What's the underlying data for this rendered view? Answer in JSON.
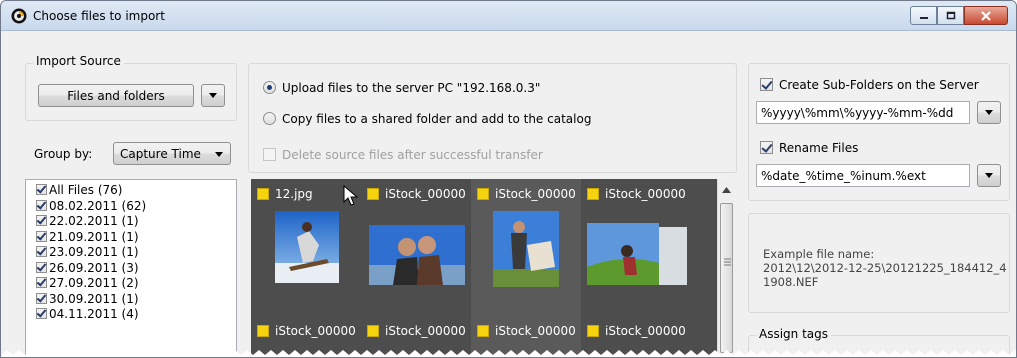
{
  "window": {
    "title": "Choose files to import",
    "controls": [
      "minimize-icon",
      "maximize-icon",
      "close-icon"
    ]
  },
  "import_source": {
    "legend": "Import Source",
    "button_label": "Files and folders"
  },
  "group_by": {
    "label": "Group by:",
    "selected": "Capture Time"
  },
  "transfer": {
    "upload_label": "Upload files to the server PC \"192.168.0.3\"",
    "copy_label": "Copy files to a shared folder and add to the catalog",
    "delete_label": "Delete source files after successful transfer",
    "upload_selected": true,
    "delete_checked": false
  },
  "tree": {
    "items": [
      {
        "label": "All Files (76)",
        "checked": true
      },
      {
        "label": "08.02.2011 (62)",
        "checked": true
      },
      {
        "label": "22.02.2011 (1)",
        "checked": true
      },
      {
        "label": "21.09.2011 (1)",
        "checked": true
      },
      {
        "label": "23.09.2011 (1)",
        "checked": true
      },
      {
        "label": "26.09.2011 (3)",
        "checked": true
      },
      {
        "label": "27.09.2011 (2)",
        "checked": true
      },
      {
        "label": "30.09.2011 (1)",
        "checked": true
      },
      {
        "label": "04.11.2011 (4)",
        "checked": true
      }
    ]
  },
  "thumbnails": {
    "top_labels": [
      "12.jpg",
      "iStock_00000",
      "iStock_00000",
      "iStock_00000"
    ],
    "bottom_labels": [
      "iStock_00000",
      "iStock_00000",
      "iStock_00000",
      "iStock_00000"
    ]
  },
  "server_options": {
    "subfolders_label": "Create Sub-Folders on the Server",
    "subfolders_checked": true,
    "subfolder_pattern": "%yyyy\\%mm\\%yyyy-%mm-%dd",
    "rename_label": "Rename Files",
    "rename_checked": true,
    "rename_pattern": "%date_%time_%inum.%ext"
  },
  "example": {
    "line1": "Example file name:",
    "line2": "2012\\12\\2012-12-25\\20121225_184412_4",
    "line3": "1908.NEF"
  },
  "tags": {
    "legend": "Assign tags"
  },
  "colors": {
    "accent_yellow": "#f5d40f",
    "thumb_bg": "#4d4d4d",
    "close_red": "#c84a30"
  }
}
